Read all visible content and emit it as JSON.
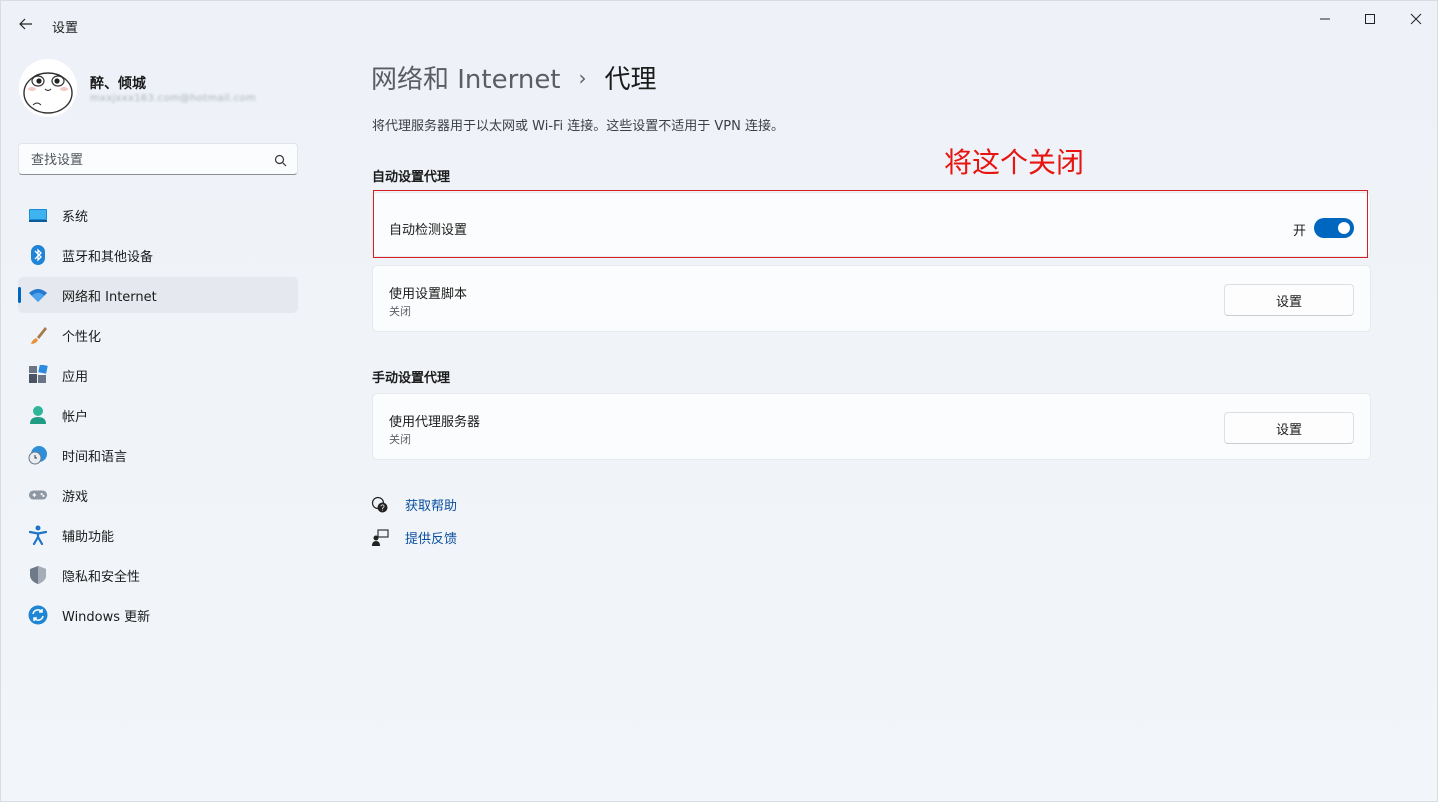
{
  "window": {
    "title": "设置"
  },
  "profile": {
    "name": "醉、倾城",
    "email": "mxxjxxx163.com@hotmail.com"
  },
  "search": {
    "placeholder": "查找设置"
  },
  "sidebar": {
    "items": [
      {
        "label": "系统",
        "icon": "system-icon",
        "active": false
      },
      {
        "label": "蓝牙和其他设备",
        "icon": "bluetooth-icon",
        "active": false
      },
      {
        "label": "网络和 Internet",
        "icon": "wifi-icon",
        "active": true
      },
      {
        "label": "个性化",
        "icon": "brush-icon",
        "active": false
      },
      {
        "label": "应用",
        "icon": "apps-icon",
        "active": false
      },
      {
        "label": "帐户",
        "icon": "account-icon",
        "active": false
      },
      {
        "label": "时间和语言",
        "icon": "clock-globe-icon",
        "active": false
      },
      {
        "label": "游戏",
        "icon": "gamepad-icon",
        "active": false
      },
      {
        "label": "辅助功能",
        "icon": "accessibility-icon",
        "active": false
      },
      {
        "label": "隐私和安全性",
        "icon": "shield-icon",
        "active": false
      },
      {
        "label": "Windows 更新",
        "icon": "update-icon",
        "active": false
      }
    ]
  },
  "main": {
    "breadcrumb_parent": "网络和 Internet",
    "breadcrumb_sep": "›",
    "breadcrumb_current": "代理",
    "description": "将代理服务器用于以太网或 Wi-Fi 连接。这些设置不适用于 VPN 连接。",
    "annotation": "将这个关闭",
    "auto_section": {
      "title": "自动设置代理",
      "auto_detect": {
        "label": "自动检测设置",
        "state": "开",
        "on": true
      },
      "script": {
        "label": "使用设置脚本",
        "status": "关闭",
        "button": "设置"
      }
    },
    "manual_section": {
      "title": "手动设置代理",
      "proxy": {
        "label": "使用代理服务器",
        "status": "关闭",
        "button": "设置"
      }
    },
    "links": {
      "help": "获取帮助",
      "feedback": "提供反馈"
    }
  },
  "colors": {
    "accent": "#0067c0",
    "annotation": "#e8140f"
  }
}
